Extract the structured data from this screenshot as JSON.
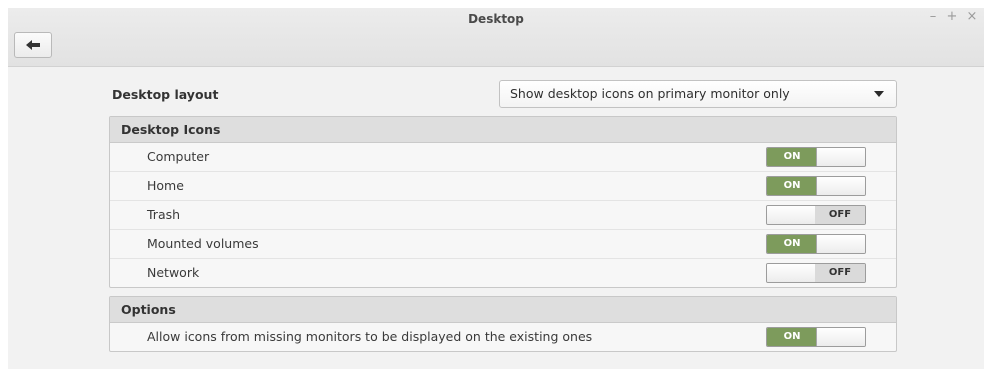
{
  "window": {
    "title": "Desktop",
    "minimize_glyph": "–",
    "maximize_glyph": "+",
    "close_glyph": "×"
  },
  "toolbar": {
    "back_icon": "back-arrow-icon"
  },
  "desktop_layout": {
    "label": "Desktop layout",
    "selected": "Show desktop icons on primary monitor only"
  },
  "desktop_icons": {
    "header": "Desktop Icons",
    "items": [
      {
        "label": "Computer",
        "state": "ON",
        "on": true
      },
      {
        "label": "Home",
        "state": "ON",
        "on": true
      },
      {
        "label": "Trash",
        "state": "OFF",
        "on": false
      },
      {
        "label": "Mounted volumes",
        "state": "ON",
        "on": true
      },
      {
        "label": "Network",
        "state": "OFF",
        "on": false
      }
    ]
  },
  "options": {
    "header": "Options",
    "items": [
      {
        "label": "Allow icons from missing monitors to be displayed on the existing ones",
        "state": "ON",
        "on": true
      }
    ]
  },
  "colors": {
    "switch_on": "#7d9b5c",
    "switch_off": "#dadada",
    "header_bg": "#dedede"
  }
}
